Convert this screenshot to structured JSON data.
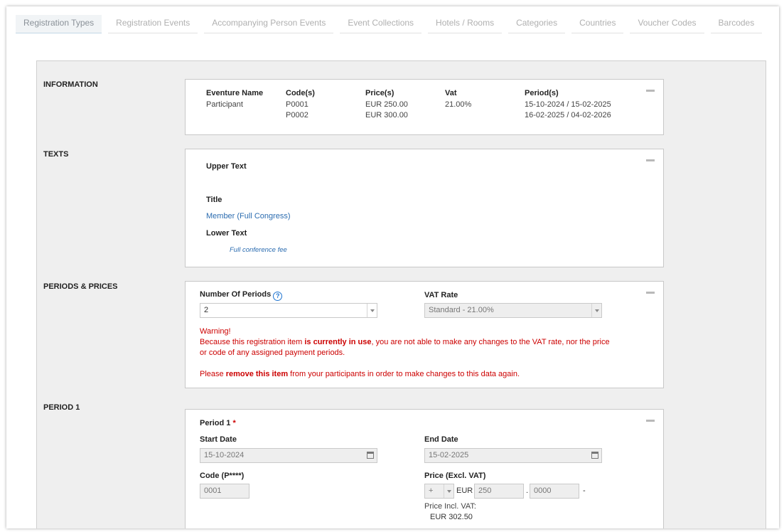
{
  "tabs": [
    {
      "label": "Registration Types",
      "active": true
    },
    {
      "label": "Registration Events"
    },
    {
      "label": "Accompanying Person Events"
    },
    {
      "label": "Event Collections"
    },
    {
      "label": "Hotels / Rooms"
    },
    {
      "label": "Categories"
    },
    {
      "label": "Countries"
    },
    {
      "label": "Voucher Codes"
    },
    {
      "label": "Barcodes"
    }
  ],
  "information": {
    "section_label": "INFORMATION",
    "headers": {
      "name": "Eventure Name",
      "codes": "Code(s)",
      "prices": "Price(s)",
      "vat": "Vat",
      "periods": "Period(s)"
    },
    "name": "Participant",
    "codes": [
      "P0001",
      "P0002"
    ],
    "prices": [
      "EUR 250.00",
      "EUR 300.00"
    ],
    "vat": "21.00%",
    "periods": [
      "15-10-2024 / 15-02-2025",
      "16-02-2025 / 04-02-2026"
    ]
  },
  "texts": {
    "section_label": "TEXTS",
    "upper_text_label": "Upper Text",
    "title_label": "Title",
    "title_value": "Member (Full Congress)",
    "lower_text_label": "Lower Text",
    "lower_text_value": "Full conference fee"
  },
  "periods_prices": {
    "section_label": "PERIODS & PRICES",
    "number_of_periods_label": "Number Of Periods",
    "number_of_periods_value": "2",
    "vat_rate_label": "VAT Rate",
    "vat_rate_value": "Standard - 21.00%",
    "warning_title": "Warning!",
    "warning_line1_pre": "Because this registration item ",
    "warning_line1_bold": "is currently in use",
    "warning_line1_post": ", you are not able to make any changes to the VAT rate, nor the price",
    "warning_line2": "or code of any assigned payment periods.",
    "warning_line3_pre": "Please ",
    "warning_line3_bold": "remove this item",
    "warning_line3_post": " from your participants in order to make changes to this data again."
  },
  "period1": {
    "section_label": "PERIOD 1",
    "title": "Period 1",
    "required_mark": "*",
    "start_date_label": "Start Date",
    "start_date_value": "15-10-2024",
    "end_date_label": "End Date",
    "end_date_value": "15-02-2025",
    "code_label": "Code (P****)",
    "code_value": "0001",
    "price_label": "Price (Excl. VAT)",
    "sign_value": "+",
    "currency": "EUR",
    "price_whole": "250",
    "decimal_sep": ".",
    "price_decimals": "0000",
    "dash": "-",
    "price_incl_label": "Price Incl. VAT:",
    "price_incl_value": "EUR 302.50"
  }
}
